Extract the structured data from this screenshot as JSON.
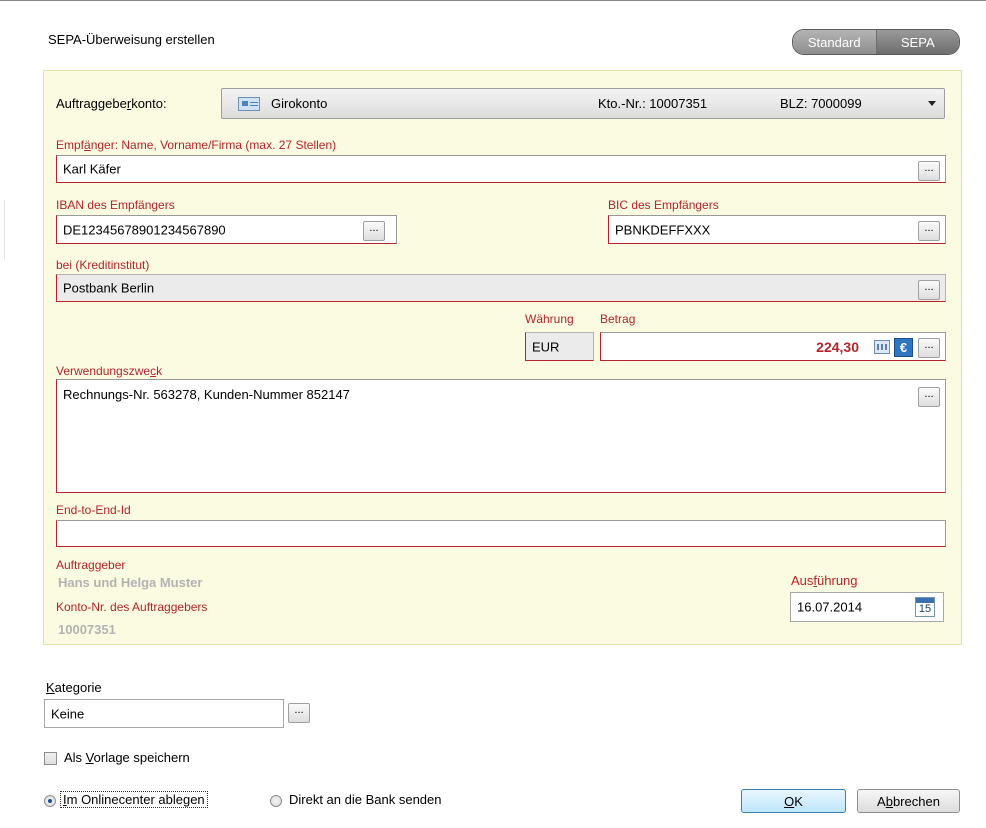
{
  "dialog": {
    "title": "SEPA-Überweisung erstellen"
  },
  "mode_toggle": {
    "standard": "Standard",
    "sepa": "SEPA",
    "selected": "SEPA"
  },
  "account": {
    "label_pre": "Auftraggebe",
    "label_u": "r",
    "label_post": "konto:",
    "name": "Girokonto",
    "kto": "Kto.-Nr.: 10007351",
    "blz": "BLZ: 7000099"
  },
  "recipient": {
    "label_pre": "Empf",
    "label_u": "ä",
    "label_post": "nger: Name, Vorname/Firma (max. 27 Stellen)",
    "value": "Karl Käfer"
  },
  "iban": {
    "label": "IBAN des Empfängers",
    "value": "DE12345678901234567890"
  },
  "bic": {
    "label": "BIC des Empfängers",
    "value": "PBNKDEFFXXX"
  },
  "bank": {
    "label": "bei (Kreditinstitut)",
    "value": "Postbank Berlin"
  },
  "currency": {
    "label": "Währung",
    "value": "EUR"
  },
  "amount": {
    "label_pre": "Betra",
    "label_u": "g",
    "label_post": "",
    "value": "224,30"
  },
  "purpose": {
    "label_pre": "Verwendungszwe",
    "label_u": "c",
    "label_post": "k",
    "value": "Rechnungs-Nr. 563278, Kunden-Nummer 852147"
  },
  "end_to_end": {
    "label": "End-to-End-Id",
    "value": ""
  },
  "originator": {
    "label": "Auftraggeber",
    "value": "Hans und Helga Muster",
    "account_label": "Konto-Nr. des Auftraggebers",
    "account_value": "10007351"
  },
  "execution": {
    "label_pre": "Aus",
    "label_u": "f",
    "label_post": "ührung",
    "date": "16.07.2014",
    "cal_day": "15"
  },
  "category": {
    "label_u": "K",
    "label_post": "ategorie",
    "value": "Keine"
  },
  "template": {
    "label_pre": "Als ",
    "label_u": "V",
    "label_post": "orlage speichern",
    "checked": false
  },
  "dest": {
    "online": {
      "label_u": "I",
      "label_post": "m Onlinecenter ablegen",
      "selected": true
    },
    "bank": {
      "label": "Direkt an die Bank senden",
      "selected": false
    }
  },
  "buttons": {
    "ok": {
      "label_u": "O",
      "label_post": "K"
    },
    "cancel": {
      "label_pre": "A",
      "label_u": "b",
      "label_post": "brechen"
    }
  },
  "dots_label": "...",
  "colors": {
    "accent_red": "#b4242a",
    "panel_bg": "#fbfbe2",
    "label_gray": "#b3b3b3"
  },
  "icons": [
    "account-card-icon",
    "dropdown-chevron-icon",
    "calculator-icon",
    "euro-icon",
    "calendar-icon"
  ]
}
